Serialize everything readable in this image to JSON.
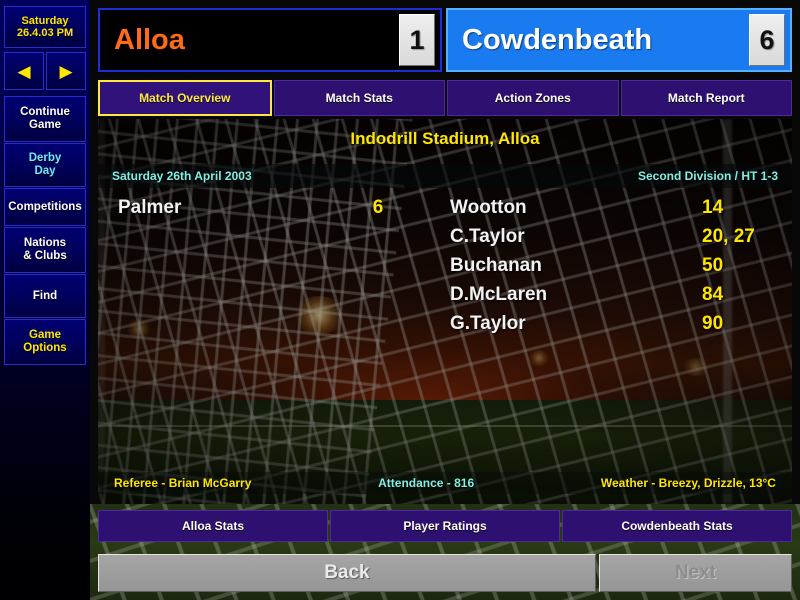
{
  "sidebar": {
    "date_line1": "Saturday",
    "date_line2": "26.4.03 PM",
    "prev_arrow": "◀",
    "next_arrow": "▶",
    "items": [
      {
        "label": "Continue\nGame",
        "color": "white"
      },
      {
        "label": "Derby\nDay",
        "color": "cyan"
      },
      {
        "label": "Competitions",
        "color": "white"
      },
      {
        "label": "Nations\n& Clubs",
        "color": "white"
      },
      {
        "label": "Find",
        "color": "white"
      },
      {
        "label": "Game\nOptions",
        "color": "yellow"
      }
    ]
  },
  "header": {
    "home_team": "Alloa",
    "home_score": "1",
    "away_team": "Cowdenbeath",
    "away_score": "6",
    "home_color": "#ff6a14",
    "away_bg": "#1a7af0"
  },
  "tabs": [
    {
      "label": "Match Overview",
      "active": true
    },
    {
      "label": "Match Stats",
      "active": false
    },
    {
      "label": "Action Zones",
      "active": false
    },
    {
      "label": "Match Report",
      "active": false
    }
  ],
  "overview": {
    "stadium": "Indodrill Stadium, Alloa",
    "date": "Saturday 26th April 2003",
    "competition": "Second Division / HT 1-3",
    "home_scorers": [
      {
        "name": "Palmer",
        "minutes": "6"
      }
    ],
    "away_scorers": [
      {
        "name": "Wootton",
        "minutes": "14"
      },
      {
        "name": "C.Taylor",
        "minutes": "20, 27"
      },
      {
        "name": "Buchanan",
        "minutes": "50"
      },
      {
        "name": "D.McLaren",
        "minutes": "84"
      },
      {
        "name": "G.Taylor",
        "minutes": "90"
      }
    ],
    "referee": "Referee - Brian McGarry",
    "attendance": "Attendance - 816",
    "weather": "Weather - Breezy, Drizzle, 13°C"
  },
  "stat_buttons": [
    {
      "label": "Alloa Stats"
    },
    {
      "label": "Player Ratings"
    },
    {
      "label": "Cowdenbeath Stats"
    }
  ],
  "nav": {
    "back_label": "Back",
    "next_label": "Next"
  }
}
